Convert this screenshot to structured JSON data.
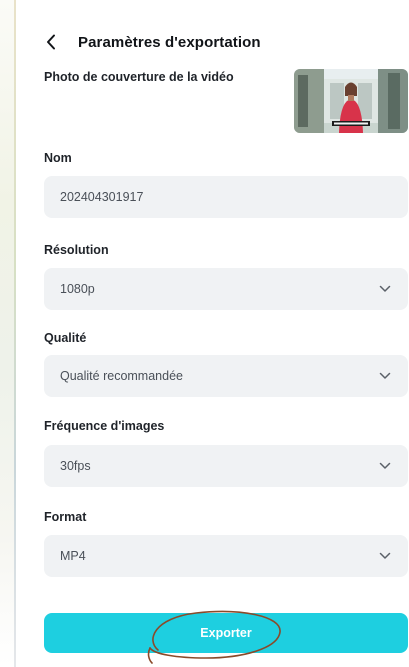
{
  "header": {
    "title": "Paramètres d'exportation",
    "back_icon": "chevron-left-icon"
  },
  "cover": {
    "label": "Photo de couverture de la vidéo",
    "thumbnail_icon": "video-cover-thumbnail"
  },
  "fields": {
    "name": {
      "label": "Nom",
      "value": "202404301917"
    },
    "resolution": {
      "label": "Résolution",
      "value": "1080p"
    },
    "quality": {
      "label": "Qualité",
      "value": "Qualité recommandée"
    },
    "framerate": {
      "label": "Fréquence d'images",
      "value": "30fps"
    },
    "format": {
      "label": "Format",
      "value": "MP4"
    }
  },
  "export_button": {
    "label": "Exporter"
  },
  "colors": {
    "accent": "#1ecfe0",
    "field_bg": "#f0f2f4",
    "annotation": "#8a4a2a"
  }
}
